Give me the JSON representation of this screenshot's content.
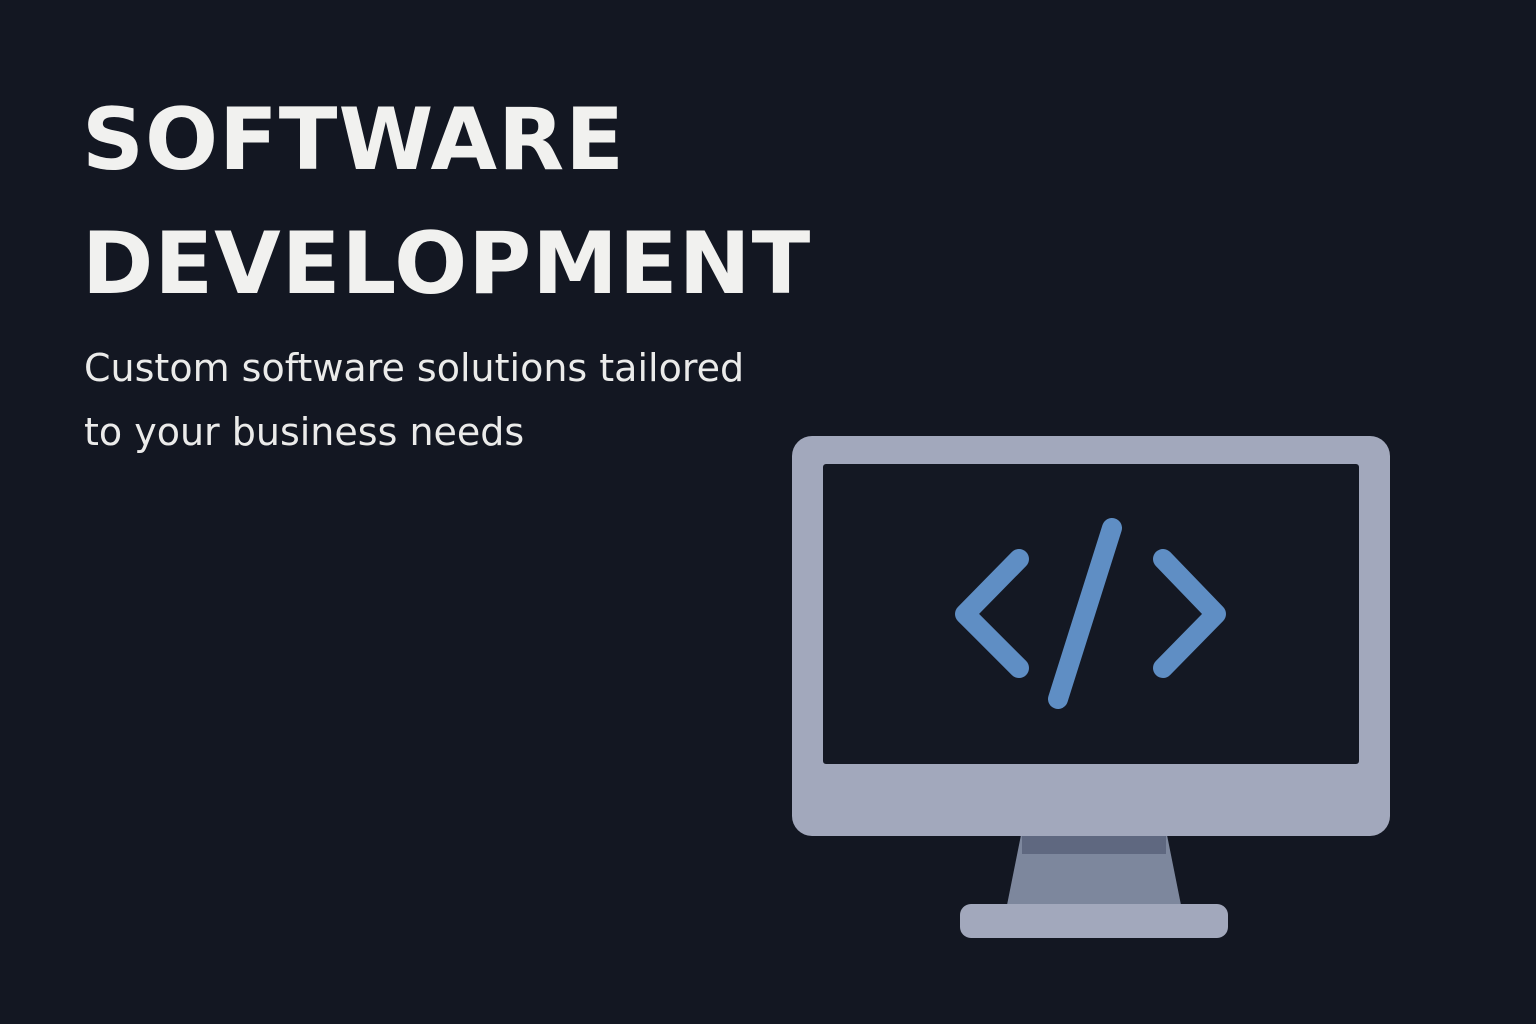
{
  "hero": {
    "title_line1": "SOFTWARE",
    "title_line2": "DEVELOPMENT",
    "subtitle_line1": "Custom software solutions tailored",
    "subtitle_line2": "to your business needs"
  },
  "illustration": {
    "icon": "monitor-code-icon",
    "glyph": "code-brackets-icon"
  },
  "colors": {
    "background": "#131722",
    "text": "#f1f1ef",
    "monitor_frame": "#a2a8bc",
    "monitor_stand": "#7d879d",
    "code_glyph": "#5f8ec4"
  }
}
